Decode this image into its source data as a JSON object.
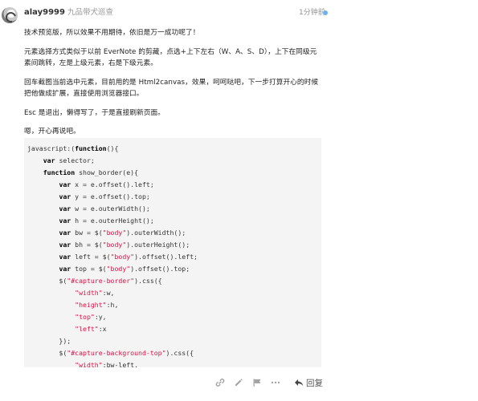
{
  "post": {
    "username": "alay9999",
    "user_title": "九品带犬巡查",
    "timestamp": "1分钟前",
    "accent_color": "#6cb2f0",
    "paragraphs": [
      "技术预览版，所以效果不用期待，依旧是万一成功呢了！",
      "元素选择方式类似于以前 EverNote 的剪藏，点选+上下左右（W、A、S、D），上下在同级元素间跳转，左是上级元素，右是下级元素。",
      "回车截图当前选中元素，目前用的是 Html2canvas，效果，呵呵哒吧，下一步打算开心的时候把他做成扩展，直接使用浏览器接口。",
      "Esc 是退出，懒得写了，于是直接刷新页面。",
      "嗯，开心再说吧。"
    ],
    "code_lines": [
      [
        {
          "t": "javascript:(",
          "c": ""
        },
        {
          "t": "function",
          "c": "kw"
        },
        {
          "t": "(){",
          "c": ""
        }
      ],
      [
        {
          "t": "    ",
          "c": ""
        },
        {
          "t": "var",
          "c": "kw"
        },
        {
          "t": " selector;",
          "c": ""
        }
      ],
      [
        {
          "t": "    ",
          "c": ""
        },
        {
          "t": "function",
          "c": "kw"
        },
        {
          "t": " show_border(e){",
          "c": ""
        }
      ],
      [
        {
          "t": "        ",
          "c": ""
        },
        {
          "t": "var",
          "c": "kw"
        },
        {
          "t": " x = e.offset().left;",
          "c": ""
        }
      ],
      [
        {
          "t": "        ",
          "c": ""
        },
        {
          "t": "var",
          "c": "kw"
        },
        {
          "t": " y = e.offset().top;",
          "c": ""
        }
      ],
      [
        {
          "t": "        ",
          "c": ""
        },
        {
          "t": "var",
          "c": "kw"
        },
        {
          "t": " w = e.outerWidth();",
          "c": ""
        }
      ],
      [
        {
          "t": "        ",
          "c": ""
        },
        {
          "t": "var",
          "c": "kw"
        },
        {
          "t": " h = e.outerHeight();",
          "c": ""
        }
      ],
      [
        {
          "t": "        ",
          "c": ""
        },
        {
          "t": "var",
          "c": "kw"
        },
        {
          "t": " bw = $(",
          "c": ""
        },
        {
          "t": "\"body\"",
          "c": "str"
        },
        {
          "t": ").outerWidth();",
          "c": ""
        }
      ],
      [
        {
          "t": "        ",
          "c": ""
        },
        {
          "t": "var",
          "c": "kw"
        },
        {
          "t": " bh = $(",
          "c": ""
        },
        {
          "t": "\"body\"",
          "c": "str"
        },
        {
          "t": ").outerHeight();",
          "c": ""
        }
      ],
      [
        {
          "t": "        ",
          "c": ""
        },
        {
          "t": "var",
          "c": "kw"
        },
        {
          "t": " left = $(",
          "c": ""
        },
        {
          "t": "\"body\"",
          "c": "str"
        },
        {
          "t": ").offset().left;",
          "c": ""
        }
      ],
      [
        {
          "t": "        ",
          "c": ""
        },
        {
          "t": "var",
          "c": "kw"
        },
        {
          "t": " top = $(",
          "c": ""
        },
        {
          "t": "\"body\"",
          "c": "str"
        },
        {
          "t": ").offset().top;",
          "c": ""
        }
      ],
      [
        {
          "t": "        $(",
          "c": ""
        },
        {
          "t": "\"#capture-border\"",
          "c": "str"
        },
        {
          "t": ").css({",
          "c": ""
        }
      ],
      [
        {
          "t": "            ",
          "c": ""
        },
        {
          "t": "\"width\"",
          "c": "str"
        },
        {
          "t": ":w,",
          "c": ""
        }
      ],
      [
        {
          "t": "            ",
          "c": ""
        },
        {
          "t": "\"height\"",
          "c": "str"
        },
        {
          "t": ":h,",
          "c": ""
        }
      ],
      [
        {
          "t": "            ",
          "c": ""
        },
        {
          "t": "\"top\"",
          "c": "str"
        },
        {
          "t": ":y,",
          "c": ""
        }
      ],
      [
        {
          "t": "            ",
          "c": ""
        },
        {
          "t": "\"left\"",
          "c": "str"
        },
        {
          "t": ":x",
          "c": ""
        }
      ],
      [
        {
          "t": "        });",
          "c": ""
        }
      ],
      [
        {
          "t": "        $(",
          "c": ""
        },
        {
          "t": "\"#capture-background-top\"",
          "c": "str"
        },
        {
          "t": ").css({",
          "c": ""
        }
      ],
      [
        {
          "t": "            ",
          "c": ""
        },
        {
          "t": "\"width\"",
          "c": "str"
        },
        {
          "t": ":bw-left,",
          "c": ""
        }
      ]
    ]
  },
  "actions": {
    "icons": [
      "link-icon",
      "edit-icon",
      "flag-icon",
      "more-icon"
    ],
    "reply_label": "回复"
  }
}
